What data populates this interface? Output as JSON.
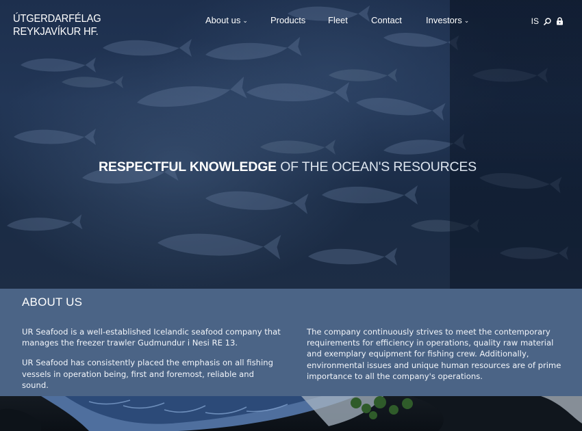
{
  "logo": {
    "line1": "ÚTGERDARFÉLAG",
    "line2": "REYKJAVÍKUR HF."
  },
  "nav": {
    "items": [
      {
        "label": "About us",
        "has_dropdown": true
      },
      {
        "label": "Products",
        "has_dropdown": false
      },
      {
        "label": "Fleet",
        "has_dropdown": false
      },
      {
        "label": "Contact",
        "has_dropdown": false
      },
      {
        "label": "Investors",
        "has_dropdown": true
      }
    ],
    "caret": "⌄"
  },
  "utility": {
    "language": "IS",
    "icons": [
      "search-icon",
      "lock-icon"
    ]
  },
  "hero": {
    "tagline_strong": "RESPECTFUL KNOWLEDGE",
    "tagline_light": "OF THE OCEAN'S RESOURCES"
  },
  "about": {
    "title": "ABOUT US",
    "left_paragraphs": [
      "UR Seafood is a well-established Icelandic seafood company that manages the freezer trawler Gudmundur i Nesi RE 13.",
      "UR Seafood has consistently placed the emphasis on all fishing vessels in operation being, first and foremost, reliable and sound."
    ],
    "right_paragraphs": [
      "The company continuously strives to meet the contemporary requirements for efficiency in operations, quality raw material and exemplary equipment for fishing crew. Additionally, environmental issues and unique human resources are of prime importance to all the company's operations."
    ]
  },
  "colors": {
    "about_bg": "#4b6486",
    "hero_bg": "#1d2f4d",
    "text": "#ffffff"
  }
}
